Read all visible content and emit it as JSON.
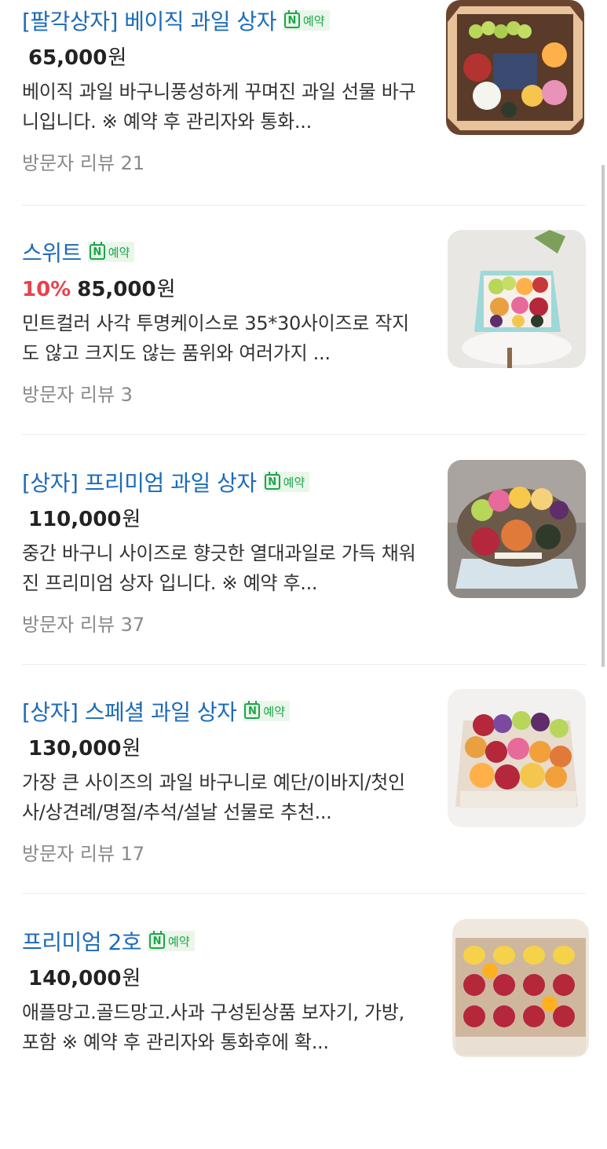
{
  "items": [
    {
      "title": "[팔각상자] 베이직 과일 상자",
      "badge": "예약",
      "discount": "",
      "price": "65,000",
      "won": "원",
      "description": "베이직 과일 바구니풍성하게 꾸며진 과일 선물 바구니입니다. ※ 예약 후 관리자와 통화...",
      "review": "방문자 리뷰 21"
    },
    {
      "title": "스위트",
      "badge": "예약",
      "discount": "10%",
      "price": "85,000",
      "won": "원",
      "description": "민트컬러 사각 투명케이스로 35*30사이즈로 작지도 않고 크지도 않는 품위와 여러가지 ...",
      "review": "방문자 리뷰 3"
    },
    {
      "title": "[상자] 프리미엄 과일 상자",
      "badge": "예약",
      "discount": "",
      "price": "110,000",
      "won": "원",
      "description": "중간 바구니 사이즈로 향긋한 열대과일로 가득 채워진 프리미엄 상자 입니다. ※ 예약 후...",
      "review": "방문자 리뷰 37"
    },
    {
      "title": "[상자] 스페셜 과일 상자",
      "badge": "예약",
      "discount": "",
      "price": "130,000",
      "won": "원",
      "description": "가장 큰 사이즈의 과일 바구니로 예단/이바지/첫인사/상견례/명절/추석/설날 선물로 추천...",
      "review": "방문자 리뷰 17"
    },
    {
      "title": "프리미엄 2호",
      "badge": "예약",
      "discount": "",
      "price": "140,000",
      "won": "원",
      "description": "애플망고.골드망고.사과 구성된상품 보자기, 가방,포함 ※ 예약 후 관리자와 통화후에 확...",
      "review": ""
    }
  ],
  "colors": {
    "title": "#1d6bb8",
    "badge": "#1aa64a",
    "discount": "#e8424c",
    "review": "#8a8a8a"
  },
  "icons": {
    "badge": "naver-reservation-icon"
  }
}
